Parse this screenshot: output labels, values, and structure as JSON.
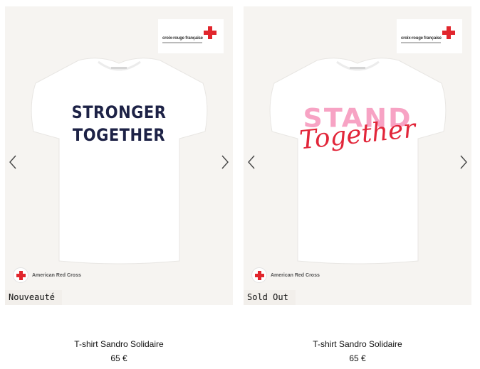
{
  "products": [
    {
      "partner_logo_text": "croix-rouge française",
      "print_lines": [
        "STRONGER",
        "TOGETHER"
      ],
      "charity_label": "American Red Cross",
      "badge": "Nouveauté",
      "name": "T-shirt Sandro Solidaire",
      "price": "65 €"
    },
    {
      "partner_logo_text": "croix-rouge française",
      "print_lines": [
        "STAND",
        "Together"
      ],
      "charity_label": "American Red Cross",
      "badge": "Sold Out",
      "name": "T-shirt Sandro Solidaire",
      "price": "65 €"
    }
  ],
  "icons": {
    "prev": "chevron-left-icon",
    "next": "chevron-right-icon",
    "partner": "red-cross-icon"
  },
  "colors": {
    "card_bg": "#f6f4f1",
    "red_cross": "#e1262d",
    "navy_print": "#1d2246",
    "pink_print": "#f7a3c4",
    "red_script": "#e2263a"
  }
}
